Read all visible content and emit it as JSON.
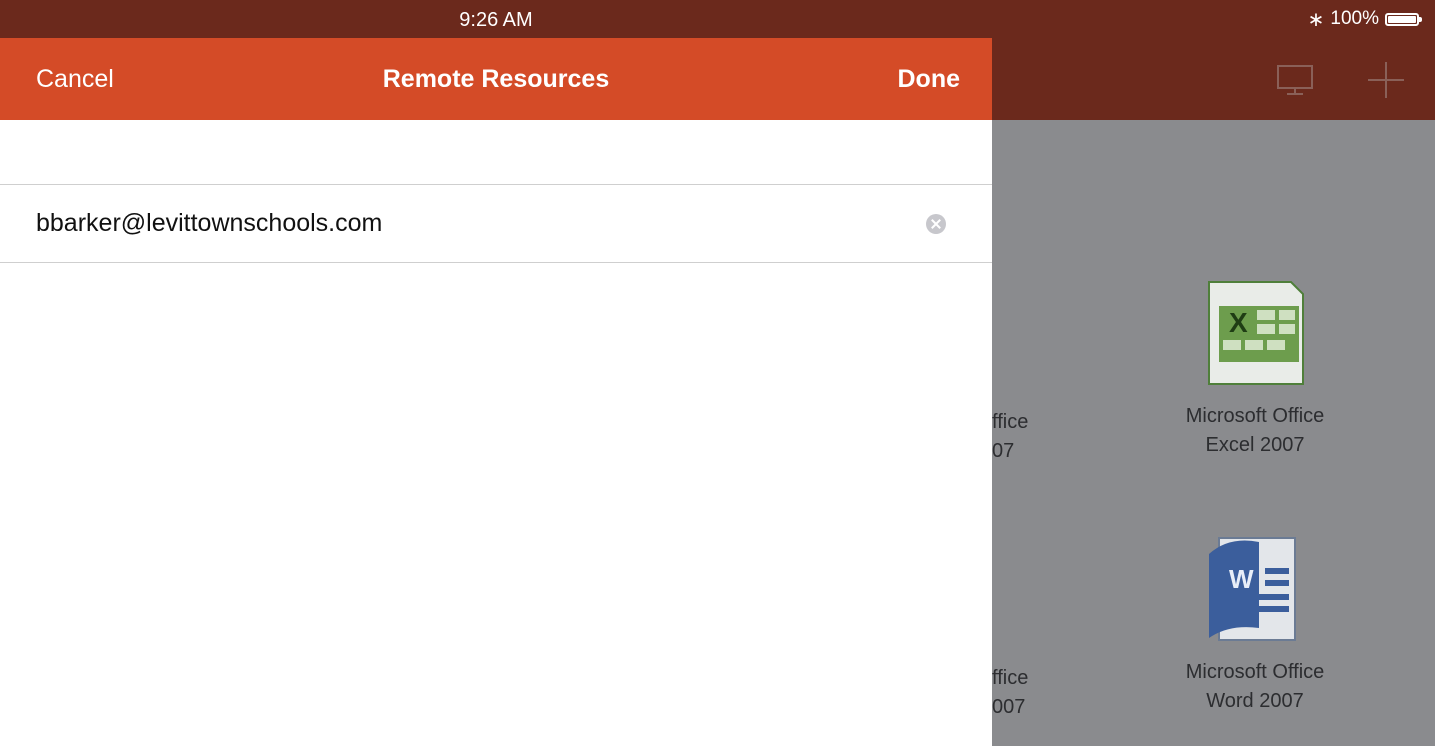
{
  "status_bar": {
    "time": "9:26 AM",
    "bluetooth_icon": "bluetooth-icon",
    "battery_text": "100%",
    "battery_level": 1.0
  },
  "background_app": {
    "toolbar_icons": [
      "monitor-icon",
      "plus-icon"
    ],
    "tiles": [
      {
        "name": "Microsoft Office Excel 2007",
        "line1": "Microsoft Office",
        "line2": "Excel 2007",
        "icon": "excel-icon",
        "accent": "#3d8a3a"
      },
      {
        "name": "Microsoft Office Word 2007",
        "line1": "Microsoft Office",
        "line2": "Word 2007",
        "icon": "word-icon",
        "accent": "#2a5aa8"
      }
    ],
    "partial_tiles": [
      {
        "line1": "ffice",
        "line2": "07"
      },
      {
        "line1": "ffice",
        "line2": "007"
      }
    ]
  },
  "modal": {
    "title": "Remote Resources",
    "cancel_label": "Cancel",
    "done_label": "Done",
    "email_value": "bbarker@levittownschools.com",
    "clear_icon": "clear-icon"
  },
  "colors": {
    "nav_bar": "#d44b27",
    "status_bar": "#6b291c",
    "dim_background": "#8a8b8e"
  }
}
